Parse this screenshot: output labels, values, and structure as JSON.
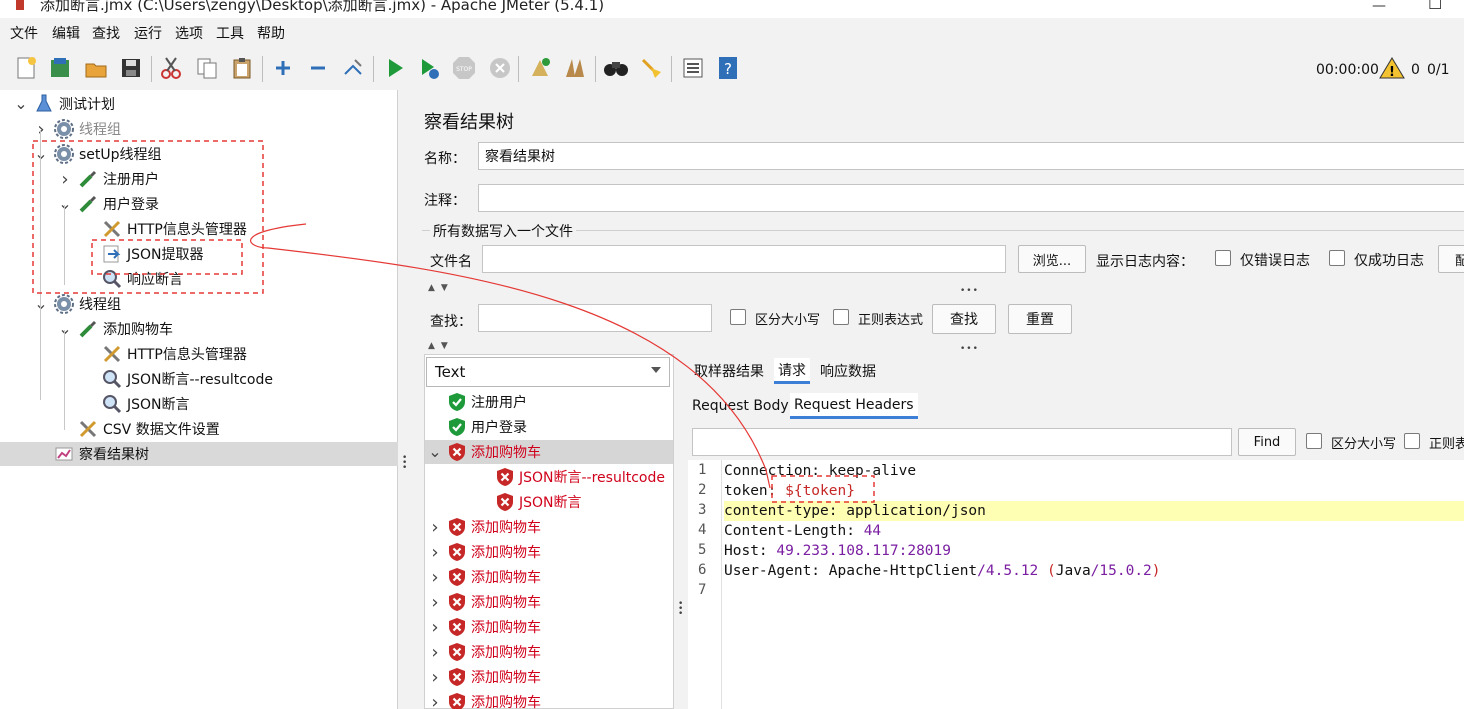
{
  "window": {
    "title": "添加断言.jmx (C:\\Users\\zengy\\Desktop\\添加断言.jmx) - Apache JMeter (5.4.1)"
  },
  "menu": [
    "文件",
    "编辑",
    "查找",
    "运行",
    "选项",
    "工具",
    "帮助"
  ],
  "toolbar": {
    "icons": [
      "new-icon",
      "templates-icon",
      "open-icon",
      "save-icon",
      "cut-icon",
      "copy-icon",
      "paste-icon",
      "expand-icon",
      "collapse-icon",
      "toggle-icon",
      "start-icon",
      "start-no-pause-icon",
      "stop-icon",
      "shutdown-icon",
      "clear-icon",
      "clear-all-icon",
      "search-icon",
      "reset-search-icon",
      "function-helper-icon",
      "help-icon"
    ],
    "timer": "00:00:00",
    "warning_count": "0",
    "threads": "0/1"
  },
  "tree": {
    "nodes": [
      {
        "label": "测试计划",
        "icon": "flask-icon",
        "expander": "v"
      },
      {
        "label": "线程组",
        "icon": "gear-icon",
        "expander": ">",
        "disabled": true
      },
      {
        "label": "setUp线程组",
        "icon": "gear-icon",
        "expander": "v"
      },
      {
        "label": "注册用户",
        "icon": "pipette-icon",
        "expander": ">"
      },
      {
        "label": "用户登录",
        "icon": "pipette-icon",
        "expander": "v"
      },
      {
        "label": "HTTP信息头管理器",
        "icon": "wrench-icon",
        "expander": ""
      },
      {
        "label": "JSON提取器",
        "icon": "extractor-icon",
        "expander": ""
      },
      {
        "label": "响应断言",
        "icon": "magnifier-icon",
        "expander": ""
      },
      {
        "label": "线程组",
        "icon": "gear-icon",
        "expander": "v"
      },
      {
        "label": "添加购物车",
        "icon": "pipette-icon",
        "expander": "v"
      },
      {
        "label": "HTTP信息头管理器",
        "icon": "wrench-icon",
        "expander": ""
      },
      {
        "label": "JSON断言--resultcode",
        "icon": "magnifier-icon",
        "expander": ""
      },
      {
        "label": "JSON断言",
        "icon": "magnifier-icon",
        "expander": ""
      },
      {
        "label": "CSV 数据文件设置",
        "icon": "wrench-icon",
        "expander": ""
      },
      {
        "label": "察看结果树",
        "icon": "chart-icon",
        "expander": "",
        "selected": true
      }
    ]
  },
  "panel": {
    "title": "察看结果树",
    "name_label": "名称：",
    "name_value": "察看结果树",
    "comment_label": "注释：",
    "comment_value": "",
    "file_section": "所有数据写入一个文件",
    "filename_label": "文件名",
    "filename_value": "",
    "browse_button": "浏览...",
    "log_label": "显示日志内容：",
    "errors_only": "仅错误日志",
    "success_only": "仅成功日志",
    "configure_partial": "配",
    "search_label": "查找：",
    "search_value": "",
    "case_sensitive": "区分大小写",
    "regex": "正则表达式",
    "find_button": "查找",
    "reset_button": "重置"
  },
  "results": {
    "renderer": "Text",
    "items": [
      {
        "label": "注册用户",
        "status": "pass",
        "expander": ""
      },
      {
        "label": "用户登录",
        "status": "pass",
        "expander": ""
      },
      {
        "label": "添加购物车",
        "status": "fail",
        "expander": "v",
        "selected": true
      },
      {
        "label": "JSON断言--resultcode",
        "status": "fail",
        "expander": "",
        "child": true
      },
      {
        "label": "JSON断言",
        "status": "fail",
        "expander": "",
        "child": true
      },
      {
        "label": "添加购物车",
        "status": "fail",
        "expander": ">"
      },
      {
        "label": "添加购物车",
        "status": "fail",
        "expander": ">"
      },
      {
        "label": "添加购物车",
        "status": "fail",
        "expander": ">"
      },
      {
        "label": "添加购物车",
        "status": "fail",
        "expander": ">"
      },
      {
        "label": "添加购物车",
        "status": "fail",
        "expander": ">"
      },
      {
        "label": "添加购物车",
        "status": "fail",
        "expander": ">"
      },
      {
        "label": "添加购物车",
        "status": "fail",
        "expander": ">"
      },
      {
        "label": "添加购物车",
        "status": "fail",
        "expander": ">"
      }
    ]
  },
  "detail": {
    "tabs": [
      "取样器结果",
      "请求",
      "响应数据"
    ],
    "active_tab": "请求",
    "subtabs": [
      "Request Body",
      "Request Headers"
    ],
    "active_subtab": "Request Headers",
    "find_value": "",
    "find_button": "Find",
    "case_sensitive": "区分大小写",
    "regex_partial": "正则表",
    "line_numbers": [
      "1",
      "2",
      "3",
      "4",
      "5",
      "6",
      "7"
    ],
    "lines": [
      [
        {
          "t": "Connection: keep-alive",
          "c": "k"
        }
      ],
      [
        {
          "t": "token: ",
          "c": "k"
        },
        {
          "t": "${token}",
          "c": "v-red"
        }
      ],
      [
        {
          "t": "content-type: application/json",
          "c": "k"
        }
      ],
      [
        {
          "t": "Content-Length: ",
          "c": "k"
        },
        {
          "t": "44",
          "c": "v-purple"
        }
      ],
      [
        {
          "t": "Host: ",
          "c": "k"
        },
        {
          "t": "49.233.108.117:28019",
          "c": "v-purple"
        }
      ],
      [
        {
          "t": "User-Agent: Apache-HttpClient",
          "c": "k"
        },
        {
          "t": "/4.5.12 ",
          "c": "v-purple"
        },
        {
          "t": "(",
          "c": "v-red"
        },
        {
          "t": "Java",
          "c": "k"
        },
        {
          "t": "/15.0.2",
          "c": "v-purple"
        },
        {
          "t": ")",
          "c": "v-red"
        }
      ],
      []
    ]
  },
  "annotation_color": "#e53935"
}
